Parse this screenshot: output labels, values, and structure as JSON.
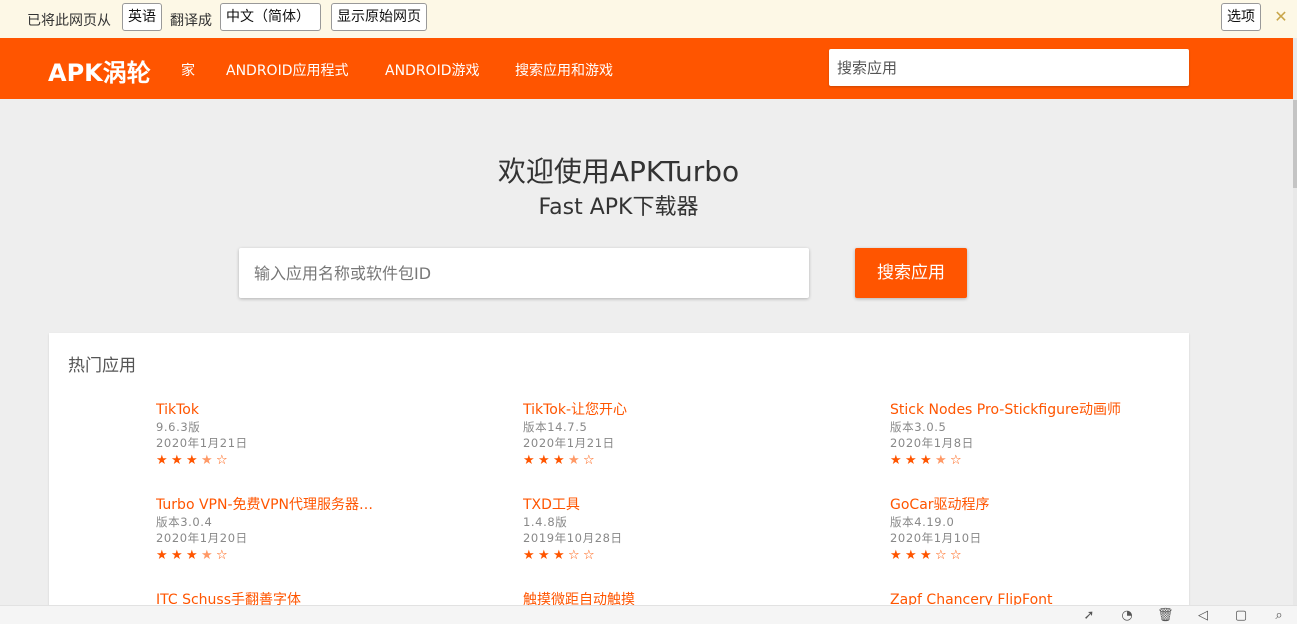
{
  "translate_bar": {
    "prefix": "已将此网页从",
    "source_lang": "英语",
    "mid": "翻译成",
    "target_lang": "中文（简体）",
    "show_original": "显示原始网页",
    "options": "选项",
    "close_icon": "close-icon"
  },
  "header": {
    "logo": "APK涡轮",
    "nav": [
      "家",
      "ANDROID应用程式",
      "ANDROID游戏",
      "搜索应用和游戏"
    ],
    "search_placeholder": "搜索应用",
    "accent_color": "#ff5500"
  },
  "hero": {
    "title": "欢迎使用APKTurbo",
    "subtitle": "Fast APK下载器",
    "search_placeholder": "输入应用名称或软件包ID",
    "search_button": "搜索应用"
  },
  "popular": {
    "title": "热门应用",
    "apps": [
      {
        "name": "TikTok",
        "version": "9.6.3版",
        "date": "2020年1月21日",
        "rating": 3.5
      },
      {
        "name": "TikTok-让您开心",
        "version": "版本14.7.5",
        "date": "2020年1月21日",
        "rating": 3.5
      },
      {
        "name": "Stick Nodes Pro-Stickfigure动画师",
        "version": "版本3.0.5",
        "date": "2020年1月8日",
        "rating": 3.5
      },
      {
        "name": "Turbo VPN-免费VPN代理服务器…",
        "version": "版本3.0.4",
        "date": "2020年1月20日",
        "rating": 3.5
      },
      {
        "name": "TXD工具",
        "version": "1.4.8版",
        "date": "2019年10月28日",
        "rating": 3
      },
      {
        "name": "GoCar驱动程序",
        "version": "版本4.19.0",
        "date": "2020年1月10日",
        "rating": 3
      },
      {
        "name": "ITC Schuss手翻善字体",
        "version": "",
        "date": "",
        "rating": null
      },
      {
        "name": "触摸微距自动触摸",
        "version": "",
        "date": "",
        "rating": null
      },
      {
        "name": "Zapf Chancery FlipFont",
        "version": "",
        "date": "",
        "rating": null
      }
    ]
  },
  "statusbar": {
    "icons": [
      "rocket-icon",
      "speed-icon",
      "trash-icon",
      "volume-icon",
      "window-icon",
      "zoom-icon"
    ]
  }
}
